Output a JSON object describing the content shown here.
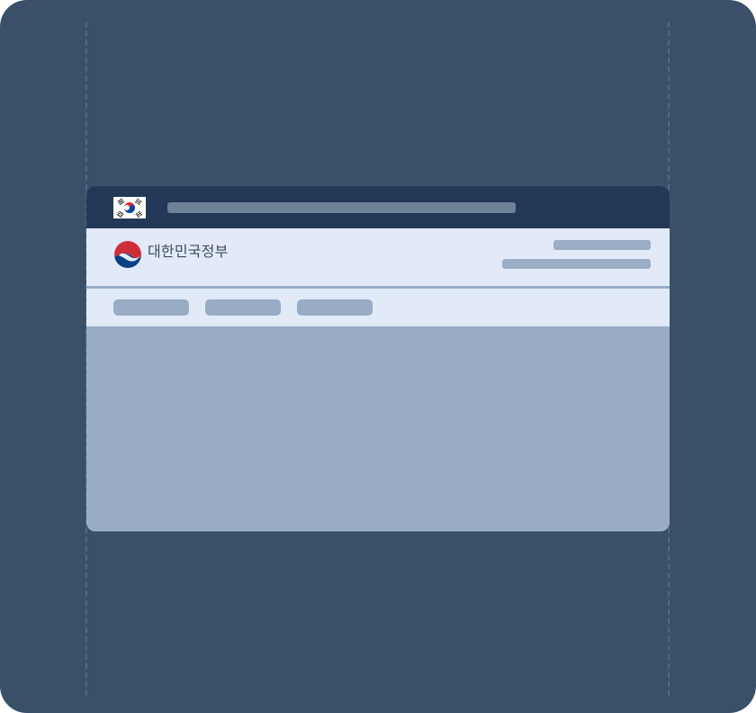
{
  "header": {
    "site_name": "대한민국정부"
  },
  "icons": {
    "flag": "korea-flag-icon",
    "emblem": "government-emblem-icon"
  },
  "colors": {
    "frame_background": "#3a5069",
    "top_bar": "#233856",
    "header_background": "#e2eaf8",
    "content_background": "#98acc5",
    "placeholder": "#9baec6"
  }
}
